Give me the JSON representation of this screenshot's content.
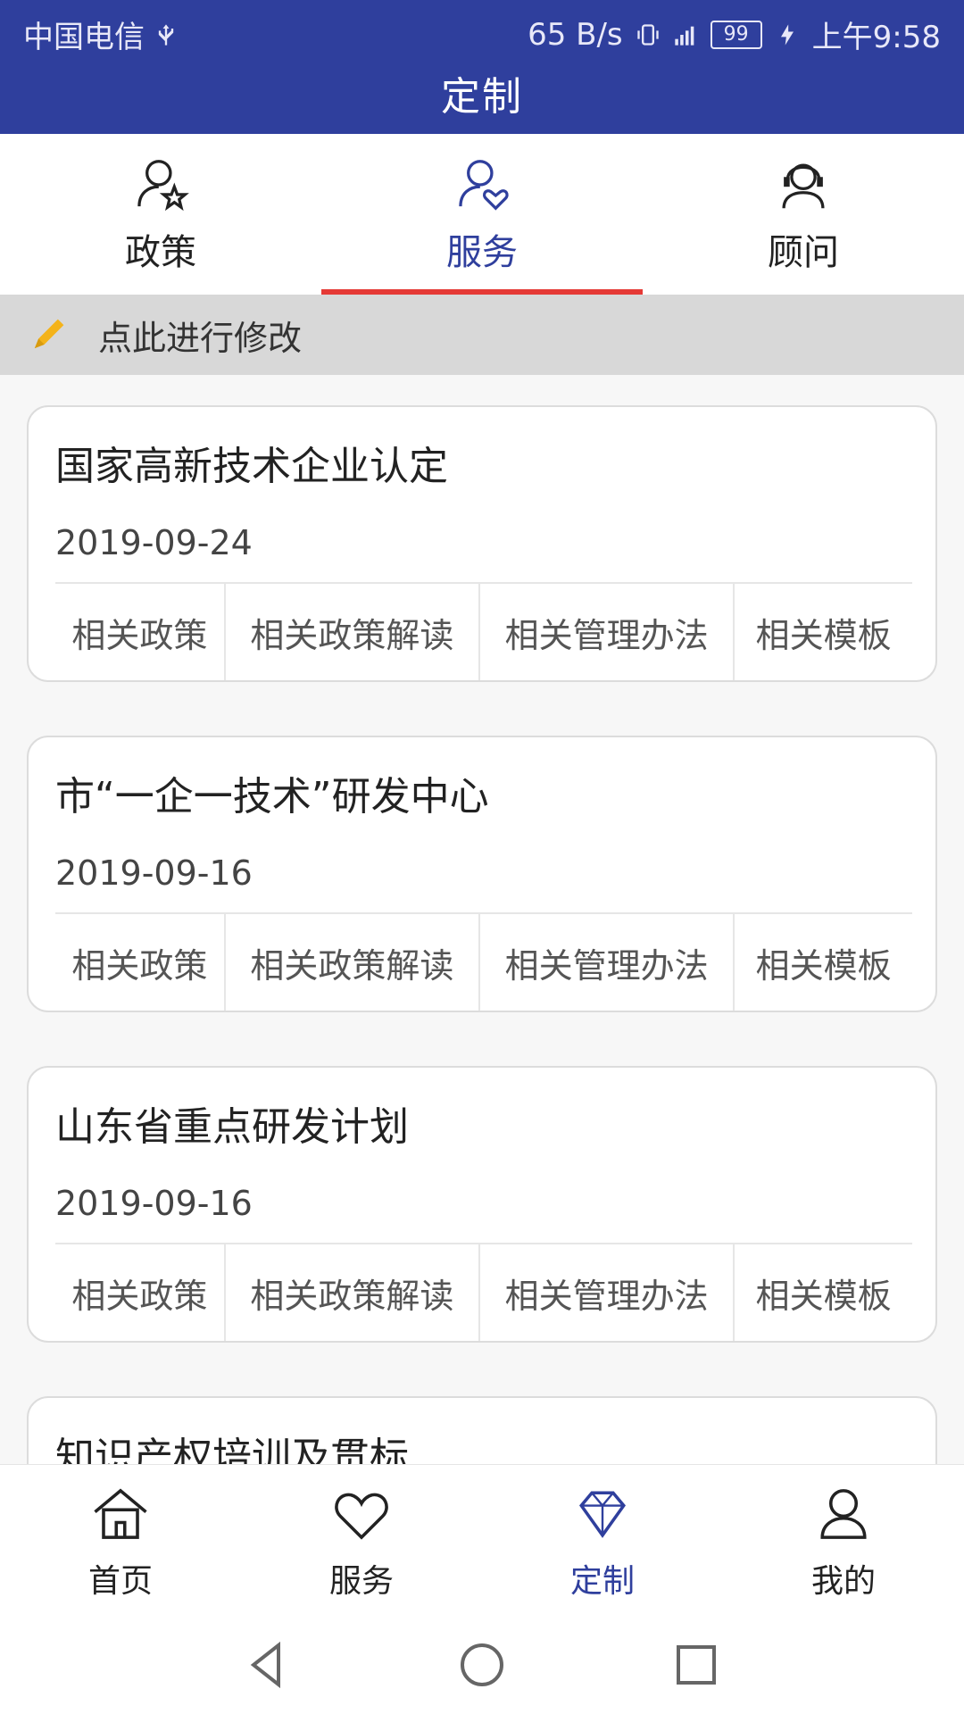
{
  "status": {
    "carrier": "中国电信",
    "net_speed": "65 B/s",
    "battery": "99",
    "time": "上午9:58"
  },
  "app": {
    "title": "定制"
  },
  "tabs": [
    {
      "label": "政策"
    },
    {
      "label": "服务"
    },
    {
      "label": "顾问"
    }
  ],
  "modify": {
    "label": "点此进行修改"
  },
  "cards": [
    {
      "title": "国家高新技术企业认定",
      "date": "2019-09-24",
      "links": [
        "相关政策",
        "相关政策解读",
        "相关管理办法",
        "相关模板"
      ]
    },
    {
      "title": "市“一企一技术”研发中心",
      "date": "2019-09-16",
      "links": [
        "相关政策",
        "相关政策解读",
        "相关管理办法",
        "相关模板"
      ]
    },
    {
      "title": "山东省重点研发计划",
      "date": "2019-09-16",
      "links": [
        "相关政策",
        "相关政策解读",
        "相关管理办法",
        "相关模板"
      ]
    },
    {
      "title": "知识产权培训及贯标"
    }
  ],
  "bottom_nav": [
    {
      "label": "首页"
    },
    {
      "label": "服务"
    },
    {
      "label": "定制"
    },
    {
      "label": "我的"
    }
  ],
  "colors": {
    "primary": "#2f3f9d",
    "underline": "#e53935",
    "pencil": "#f4b31a"
  }
}
